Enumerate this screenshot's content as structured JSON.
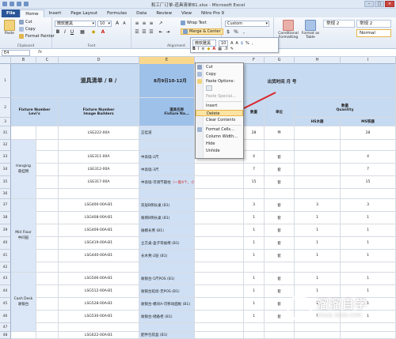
{
  "window": {
    "title": "和工厂订单-道具清单B1.xlsx - Microsoft Excel"
  },
  "tabs": [
    "File",
    "Home",
    "Insert",
    "Page Layout",
    "Formulas",
    "Data",
    "Review",
    "View",
    "Nitro Pro 9"
  ],
  "ribbon": {
    "paste_label": "Paste",
    "cut_label": "Cut",
    "copy_label": "Copy",
    "format_painter_label": "Format Painter",
    "clipboard_label": "Clipboard",
    "font_name": "微软雅黑",
    "font_size": "10",
    "font_label": "Font",
    "wrap_text_label": "Wrap Text",
    "merge_center_label": "Merge & Center",
    "alignment_label": "Alignment",
    "number_format": "Custom",
    "number_label": "Number",
    "conditional_formatting_label": "Conditional Formatting",
    "format_as_table_label": "Format as Table",
    "style_normal2_1": "常规 2",
    "style_normal2_2": "常规 2",
    "style_normal": "Normal"
  },
  "formula_bar": {
    "name_box": "E4",
    "fx": "fx"
  },
  "columns": [
    "B",
    "C",
    "D",
    "E",
    "F",
    "G",
    "H",
    "I"
  ],
  "rows": [
    "1",
    "2",
    "3",
    "31",
    "32",
    "33",
    "34",
    "35",
    "36",
    "37",
    "38",
    "39",
    "40",
    "41",
    "42",
    "43",
    "44",
    "45",
    "46",
    "47",
    "48"
  ],
  "sheet": {
    "title": "道具清单 / B /",
    "date": "8月9日10-12月",
    "ship_date": "出货时间  月 号",
    "hdr_levels": "Fixture Number\nLevi's",
    "hdr_image": "Fixture Number\nImage Builders",
    "hdr_name": "道具名称\nFixture Na...",
    "hdr_qty_label": "数量",
    "hdr_unit": "单位",
    "hdr_quantity": "数量\nQuantity",
    "hdr_hs": "HS木器",
    "hdr_ms": "MS铁器",
    "group_hanging": "Hanging\n悬挂物",
    "group_midfloor": "Mid Floor\n中间层",
    "group_cashdesk": "Cash Desk\n收银台",
    "r31": {
      "code": "LSG222-00A",
      "name": "正挂道",
      "qty": "28",
      "unit": "件",
      "ms": "28"
    },
    "r33": {
      "code": "LSG311-00A",
      "name": "中高墙-2尺",
      "qty": "4",
      "unit": "套",
      "ms": "4"
    },
    "r34": {
      "code": "LSG312-00A",
      "name": "中高墙-3尺",
      "qty": "7",
      "unit": "套",
      "ms": "7"
    },
    "r35": {
      "code": "LSG317-00A",
      "name": "中高墙-可调节圆柱",
      "name_red": "（一套4个，小计15个）",
      "qty": "15",
      "unit": "套",
      "ms": "15"
    },
    "r37": {
      "code": "LSG400-00A-B1",
      "name": "双层B侧长桌 (B1)",
      "qty": "3",
      "unit": "套",
      "hs": "3",
      "ms": "3"
    },
    "r38": {
      "code": "LSG408-00A-B1",
      "name": "尾侧B侧长桌 (B1)",
      "qty": "1",
      "unit": "套",
      "hs": "1",
      "ms": "1"
    },
    "r39": {
      "code": "LSG409-00A-B1",
      "name": "展模长凳 (B1)",
      "qty": "1",
      "unit": "套",
      "hs": "1",
      "ms": "1"
    },
    "r40": {
      "code": "LSG419-00A-B1",
      "name": "立方桌-盒子等候椅 (B1)",
      "qty": "1",
      "unit": "套",
      "hs": "1",
      "ms": "1"
    },
    "r41": {
      "code": "LSG440-00A-B1",
      "name": "长木凳-2层 (B1)",
      "qty": "1",
      "unit": "套",
      "hs": "1",
      "ms": "1"
    },
    "r43": {
      "code": "LSG506-00A-B1",
      "name": "收银台-5尺POS (B1)",
      "qty": "1",
      "unit": "套",
      "hs": "1",
      "ms": "1"
    },
    "r44": {
      "code": "LSG512-00A-B1",
      "name": "收银台延续-无POS (B1)",
      "qty": "1",
      "unit": "套",
      "hs": "1",
      "ms": "1"
    },
    "r45": {
      "code": "LSG528-00A-B1",
      "name": "收银台-模块A-可移动面板 (B1)",
      "qty": "1",
      "unit": "套",
      "hs": "1",
      "ms": "1"
    },
    "r46": {
      "code": "LSG530-00A-B1",
      "name": "收银台-储备柜 (B1)",
      "qty": "1",
      "unit": "套",
      "hs": "1",
      "ms": "1"
    },
    "r48": {
      "code": "LSG622-00A-B1",
      "name": "配件包装盒 (B1)",
      "qty": "",
      "unit": "",
      "hs": "",
      "ms": ""
    }
  },
  "mini_toolbar": {
    "font": "微软雅黑",
    "size": "10"
  },
  "context_menu": {
    "cut": "Cut",
    "copy": "Copy",
    "paste_options": "Paste Options:",
    "paste_special": "Paste Special...",
    "insert": "Insert",
    "delete": "Delete",
    "clear_contents": "Clear Contents",
    "format_cells": "Format Cells...",
    "column_width": "Column Width...",
    "hide": "Hide",
    "unhide": "Unhide"
  },
  "watermark": {
    "cn": "溜溜自学",
    "url": "ZIXUE.3D66.COM"
  },
  "colors": {
    "file_tab": "#2a5699",
    "header_fill": "#c6daf1",
    "selected_column": "#9ec1ea",
    "arrow": "#d9262a",
    "menu_highlight": "#fbe3a4"
  }
}
